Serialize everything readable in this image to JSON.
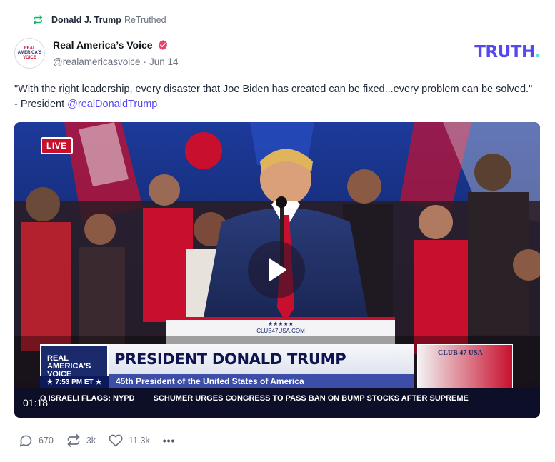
{
  "retruth": {
    "user": "Donald J. Trump",
    "action": "ReTruthed",
    "icon": "retruth-icon"
  },
  "author": {
    "avatar_text": [
      "REAL",
      "AMERICA'S",
      "VOICE"
    ],
    "display_name": "Real America’s Voice",
    "handle": "@realamericasvoice",
    "separator": "·",
    "date": "Jun 14",
    "verified": true
  },
  "brand": {
    "logo_text": "TRUTH",
    "logo_dot": "."
  },
  "post": {
    "text": "\"With the right leadership, every disaster that Joe Biden has created can be fixed...every problem can be solved.\" - President ",
    "mention": "@realDonaldTrump"
  },
  "video": {
    "live_badge": "LIVE",
    "duration": "01:18",
    "chyron_logo": [
      "REAL",
      "AMERICA'S",
      "VOICE"
    ],
    "chyron_time": "7:53 PM ET",
    "headline": "PRESIDENT DONALD TRUMP",
    "subheadline": "45th President of the United States of America",
    "club_label": "CLUB 47 USA",
    "ticker_left": "O ISRAELI FLAGS: NYPD",
    "ticker_right": "SCHUMER URGES CONGRESS TO PASS BAN ON BUMP STOCKS AFTER SUPREME",
    "podium_text": "CLUB47USA.COM"
  },
  "actions": {
    "replies": "670",
    "retruths": "3k",
    "likes": "11.3k",
    "more": "•••"
  },
  "colors": {
    "brand_purple": "#5448ee",
    "brand_teal": "#5ee3c8",
    "verified_pink": "#e8416f",
    "retruth_green": "#17b26a"
  }
}
